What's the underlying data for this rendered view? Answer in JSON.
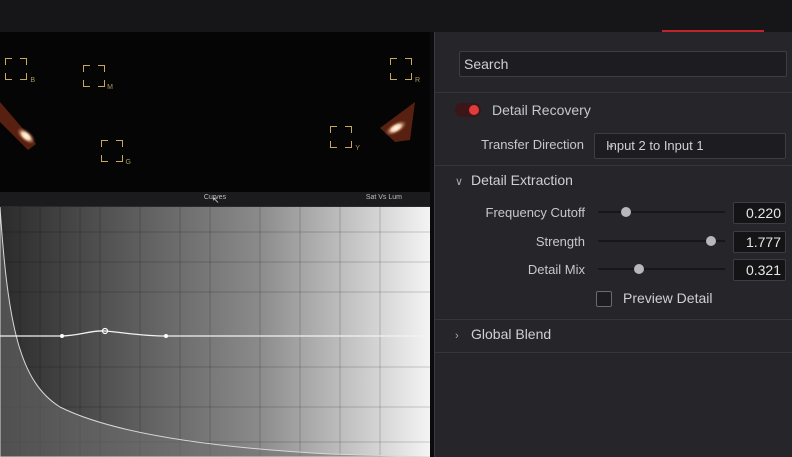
{
  "viewer": {
    "vectorscope_labels": [
      "B",
      "M",
      "G",
      "R",
      "Y"
    ],
    "curve_panel_title": "Curves",
    "curve_mode": "Sat Vs Lum"
  },
  "inspector": {
    "search": {
      "placeholder": "Search"
    },
    "effect": {
      "name": "Detail Recovery",
      "enabled": true
    },
    "transfer_direction": {
      "label": "Transfer Direction",
      "value": "Input 2 to Input 1"
    },
    "detail_extraction": {
      "title": "Detail Extraction",
      "expanded": true,
      "params": [
        {
          "label": "Frequency Cutoff",
          "value": "0.220",
          "position": 0.22
        },
        {
          "label": "Strength",
          "value": "1.777",
          "position": 0.89
        },
        {
          "label": "Detail Mix",
          "value": "0.321",
          "position": 0.32
        }
      ],
      "preview": {
        "label": "Preview Detail",
        "checked": false
      }
    },
    "global_blend": {
      "title": "Global Blend",
      "expanded": false
    }
  },
  "colors": {
    "accent_red": "#e23b3b",
    "panel_bg": "#25252a"
  }
}
